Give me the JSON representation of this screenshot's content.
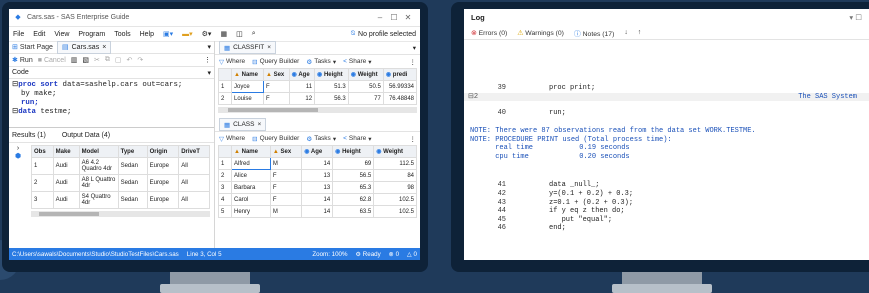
{
  "sas": {
    "window_title": "Cars.sas - SAS Enterprise Guide",
    "menu": [
      "File",
      "Edit",
      "View",
      "Program",
      "Tools",
      "Help"
    ],
    "profile": "No profile selected",
    "tabs": [
      "Start Page",
      "Cars.sas"
    ],
    "toolbar": [
      "Run",
      "Cancel"
    ],
    "code_label": "Code",
    "code_lines": [
      {
        "kw": "proc sort",
        "rest": " data=sashelp.cars out=cars;"
      },
      {
        "kw": "",
        "rest": "by make;"
      },
      {
        "kw": "",
        "rest": "run;"
      },
      {
        "kw": "data",
        "rest": " testme;"
      }
    ],
    "results_tabs": [
      "Results (1)",
      "Output Data (4)"
    ],
    "results_columns": [
      "Obs",
      "Make",
      "Model",
      "Type",
      "Origin",
      "DriveT"
    ],
    "results_rows": [
      [
        "1",
        "Audi",
        "A6 4.2 Quadro 4dr",
        "Sedan",
        "Europe",
        "All"
      ],
      [
        "2",
        "Audi",
        "A8 L Quattro 4dr",
        "Sedan",
        "Europe",
        "All"
      ],
      [
        "3",
        "Audi",
        "S4 Quattro 4dr",
        "Sedan",
        "Europe",
        "All"
      ]
    ],
    "classfit": {
      "tab": "CLASSFIT",
      "toolbar": [
        "Where",
        "Query Builder",
        "Tasks",
        "Share"
      ],
      "columns": [
        "",
        "Name",
        "Sex",
        "Age",
        "Height",
        "Weight",
        "predi"
      ],
      "rows": [
        [
          "1",
          "Joyce",
          "F",
          "11",
          "51.3",
          "50.5",
          "56.99334"
        ],
        [
          "2",
          "Louise",
          "F",
          "12",
          "56.3",
          "77",
          "76.48848"
        ]
      ]
    },
    "class": {
      "tab": "CLASS",
      "toolbar": [
        "Where",
        "Query Builder",
        "Tasks",
        "Share"
      ],
      "columns": [
        "",
        "Name",
        "Sex",
        "Age",
        "Height",
        "Weight"
      ],
      "rows": [
        [
          "1",
          "Alfred",
          "M",
          "14",
          "69",
          "112.5"
        ],
        [
          "2",
          "Alice",
          "F",
          "13",
          "56.5",
          "84"
        ],
        [
          "3",
          "Barbara",
          "F",
          "13",
          "65.3",
          "98"
        ],
        [
          "4",
          "Carol",
          "F",
          "14",
          "62.8",
          "102.5"
        ],
        [
          "5",
          "Henry",
          "M",
          "14",
          "63.5",
          "102.5"
        ]
      ]
    },
    "status": {
      "path": "C:\\Users\\sawals\\Documents\\Studio\\StudioTestFiles\\Cars.sas",
      "pos": "Line 3, Col 5",
      "zoom": "Zoom: 100%",
      "ready": "Ready",
      "errors": "0",
      "warnings": "0"
    },
    "accent": "#2a7be3"
  },
  "log": {
    "title": "Log",
    "filters": [
      "Errors (0)",
      "Warnings (0)",
      "Notes (17)"
    ],
    "system_label": "The SAS System",
    "lines_top": [
      {
        "n": "39",
        "t": "     proc print;"
      },
      {
        "n": "2",
        "t": ""
      }
    ],
    "lines_mid": [
      {
        "n": "40",
        "t": "     run;"
      }
    ],
    "notes": [
      "NOTE: There were 87 observations read from the data set WORK.TESTME.",
      "NOTE: PROCEDURE PRINT used (Total process time):",
      "      real time           0.19 seconds",
      "      cpu time            0.20 seconds"
    ],
    "lines_bottom": [
      {
        "n": "41",
        "t": "     data _null_;"
      },
      {
        "n": "42",
        "t": "     y=(0.1 + 0.2) + 0.3;"
      },
      {
        "n": "43",
        "t": "     z=0.1 + (0.2 + 0.3);"
      },
      {
        "n": "44",
        "t": "     if y eq z then do;"
      },
      {
        "n": "45",
        "t": "        put \"equal\";"
      },
      {
        "n": "46",
        "t": "     end;"
      }
    ]
  }
}
